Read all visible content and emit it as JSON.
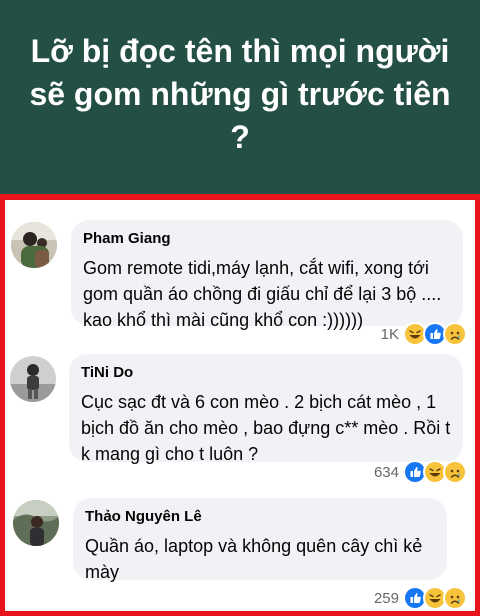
{
  "banner": {
    "title": "Lỡ bị đọc tên thì mọi người sẽ gom những gì trước tiên ?"
  },
  "accent_colors": {
    "banner_bg": "#234f45",
    "frame_border": "#e8131c",
    "bubble_bg": "#f0f2f5",
    "like_blue": "#1877f2",
    "haha_yellow": "#f7c33b"
  },
  "comments": [
    {
      "author": "Pham Giang",
      "text": "Gom remote tidi,máy lạnh, cắt wifi, xong tới gom quần áo chồng đi giấu chỉ để lại 3 bộ .... kao khổ thì mài cũng khổ con :))))))",
      "reaction_count": "1K",
      "reactions": [
        "haha-icon",
        "like-icon",
        "sad-icon"
      ]
    },
    {
      "author": "TiNi Do",
      "text": "Cục sạc đt và 6 con mèo . 2 bịch cát mèo , 1 bịch đồ ăn cho mèo , bao đựng c** mèo . Rồi t k mang gì cho t luôn ?",
      "reaction_count": "634",
      "reactions": [
        "like-icon",
        "haha-icon",
        "sad-icon"
      ]
    },
    {
      "author": "Thảo Nguyên Lê",
      "text": "Quần áo, laptop và không quên cây chì kẻ mày",
      "reaction_count": "259",
      "reactions": [
        "like-icon",
        "haha-icon",
        "sad-icon"
      ]
    }
  ]
}
